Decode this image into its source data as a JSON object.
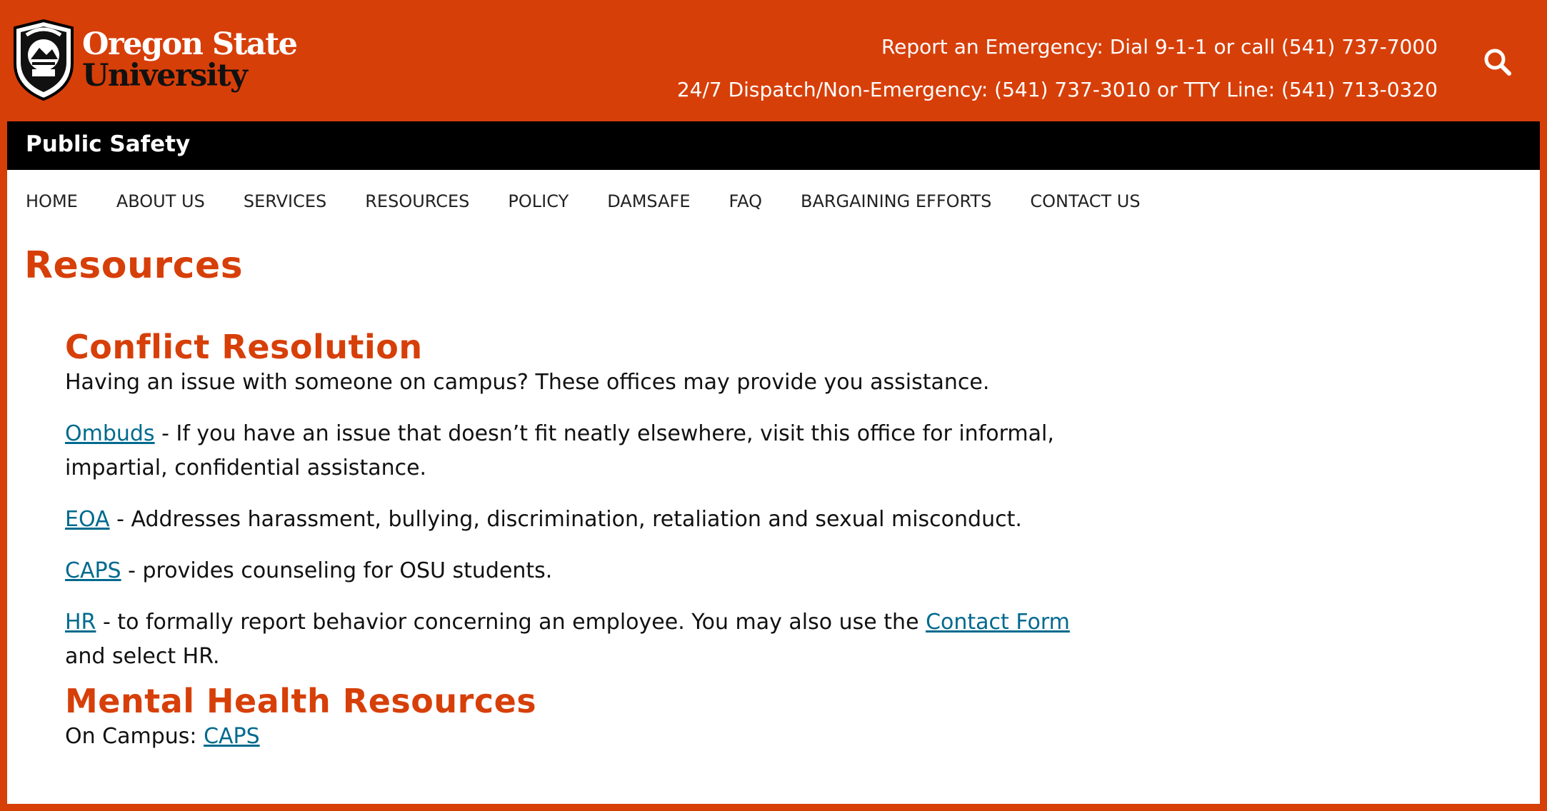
{
  "header": {
    "logo": {
      "line1": "Oregon State",
      "line2": "University"
    },
    "emergency_line": "Report an Emergency: Dial 9-1-1 or call (541) 737-7000",
    "dispatch_line": "24/7 Dispatch/Non-Emergency: (541) 737-3010 or TTY Line: (541) 713-0320",
    "search_icon": "search-icon"
  },
  "unit": {
    "name": "Public Safety"
  },
  "nav": {
    "items": [
      {
        "label": "HOME"
      },
      {
        "label": "ABOUT US"
      },
      {
        "label": "SERVICES"
      },
      {
        "label": "RESOURCES"
      },
      {
        "label": "POLICY"
      },
      {
        "label": "DAMSAFE"
      },
      {
        "label": "FAQ"
      },
      {
        "label": "BARGAINING EFFORTS"
      },
      {
        "label": "CONTACT US"
      }
    ]
  },
  "page": {
    "title": "Resources"
  },
  "sections": {
    "conflict": {
      "heading": "Conflict Resolution",
      "intro": "Having an issue with someone on campus? These offices may provide you assistance.",
      "ombuds": {
        "link": "Ombuds",
        "text": " - If you have an issue that doesn’t fit neatly elsewhere, visit this office for informal, impartial, confidential assistance."
      },
      "eoa": {
        "link": "EOA",
        "text": " - Addresses harassment, bullying, discrimination, retaliation and sexual misconduct."
      },
      "caps": {
        "link": "CAPS",
        "text": " - provides counseling for OSU students."
      },
      "hr": {
        "link": "HR",
        "text1": " - to formally report behavior concerning an employee. You may also use the ",
        "link2": "Contact Form",
        "text2": " and select HR."
      }
    },
    "mental": {
      "heading": "Mental Health Resources",
      "on_campus_label": "On Campus: ",
      "on_campus_link": "CAPS"
    }
  },
  "colors": {
    "brand_orange": "#D73F09",
    "link": "#006A8E",
    "bar": "#000000"
  }
}
